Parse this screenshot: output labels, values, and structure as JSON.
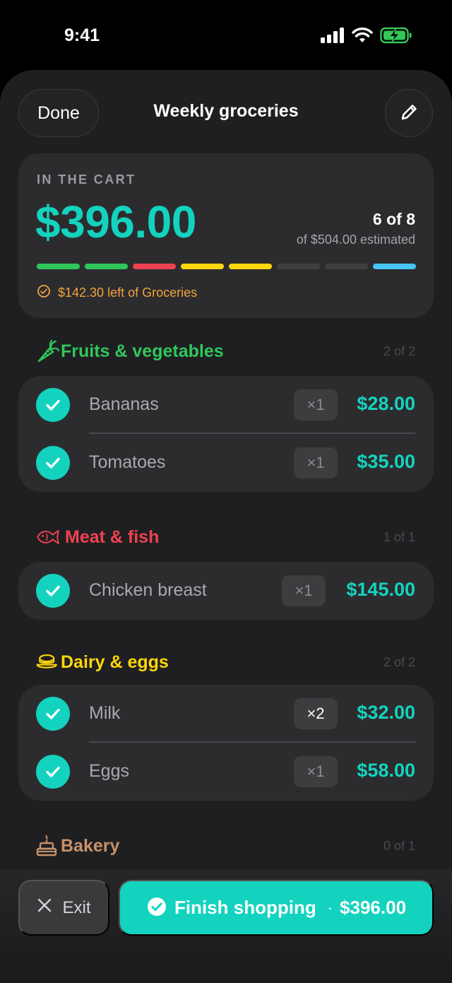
{
  "status_bar": {
    "time": "9:41",
    "battery_color": "#34c759"
  },
  "nav": {
    "done_label": "Done",
    "title": "Weekly groceries",
    "edit_icon": "pencil-icon"
  },
  "cart": {
    "kicker": "IN THE CART",
    "total": "$396.00",
    "count": "6 of 8",
    "estimated": "of $504.00 estimated",
    "progress_segments": [
      {
        "category": "Fruits & vegetables",
        "color": "#30c75a",
        "checked": true
      },
      {
        "category": "Fruits & vegetables",
        "color": "#30c75a",
        "checked": true
      },
      {
        "category": "Meat & fish",
        "color": "#ef4250",
        "checked": true
      },
      {
        "category": "Dairy & eggs",
        "color": "#ffd60a",
        "checked": true
      },
      {
        "category": "Dairy & eggs",
        "color": "#ffd60a",
        "checked": true
      },
      {
        "category": "Bakery",
        "color": "#3f3f42",
        "checked": false
      },
      {
        "category": "Bakery",
        "color": "#3f3f42",
        "checked": false
      },
      {
        "category": "Other",
        "color": "#48c4f5",
        "checked": true
      }
    ],
    "budget_text": "$142.30 left of Groceries",
    "budget_color": "#f1a33c"
  },
  "categories": [
    {
      "title": "Fruits & vegetables",
      "count": "2 of 2",
      "color": "#30c75a",
      "icon": "carrot-icon",
      "items": [
        {
          "name": "Bananas",
          "qty": "×1",
          "price": "$28.00"
        },
        {
          "name": "Tomatoes",
          "qty": "×1",
          "price": "$35.00"
        }
      ]
    },
    {
      "title": "Meat & fish",
      "count": "1 of 1",
      "color": "#ef4250",
      "icon": "fish-icon",
      "items": [
        {
          "name": "Chicken breast",
          "qty": "×1",
          "price": "$145.00"
        }
      ]
    },
    {
      "title": "Dairy & eggs",
      "count": "2 of 2",
      "color": "#ffd60a",
      "icon": "dairy-bowl-icon",
      "items": [
        {
          "name": "Milk",
          "qty": "×2",
          "price": "$32.00"
        },
        {
          "name": "Eggs",
          "qty": "×1",
          "price": "$58.00"
        }
      ]
    },
    {
      "title": "Bakery",
      "count": "0 of 1",
      "color": "#c8916a",
      "icon": "cake-icon",
      "items": []
    }
  ],
  "footer": {
    "exit_label": "Exit",
    "finish_label": "Finish shopping",
    "finish_separator": "·",
    "finish_total": "$396.00"
  },
  "accent": "#13d3bf"
}
